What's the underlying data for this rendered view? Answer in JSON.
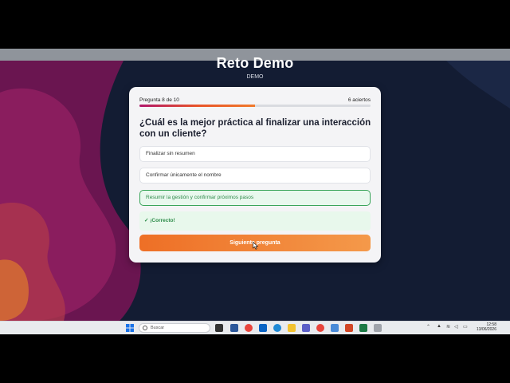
{
  "app": {
    "title": "Reto Demo",
    "subtitle": "DEMO"
  },
  "quiz": {
    "question_counter": "Pregunta 8 de 10",
    "score": "6 aciertos",
    "progress": 0.5,
    "question": "¿Cuál es la mejor práctica al finalizar una interacción con un cliente?",
    "options": [
      "Finalizar sin resumen",
      "Confirmar únicamente el nombre",
      "Resumir la gestión y confirmar próximos pasos"
    ],
    "selected_option": 2,
    "feedback": "✓ ¡Correcto!",
    "next_button": "Siguiente pregunta"
  },
  "taskbar": {
    "search_placeholder": "Buscar",
    "time": "12:58",
    "date": "13/06/2026"
  },
  "colors": {
    "accent": "#ee6f26",
    "correct": "#2e8a4a",
    "background": "#131c33"
  }
}
